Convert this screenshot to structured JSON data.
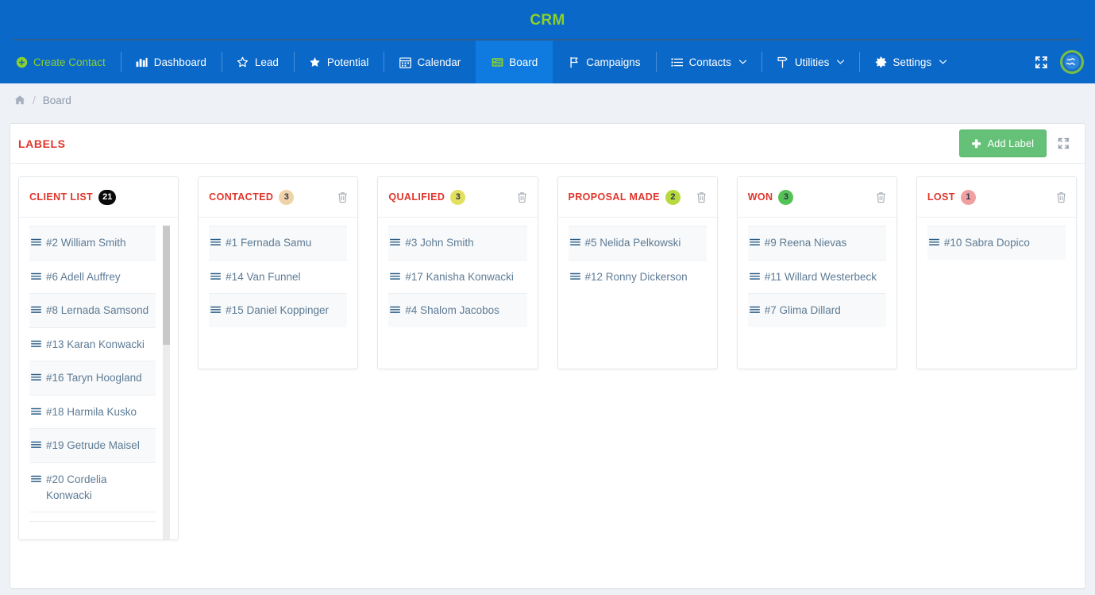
{
  "app": {
    "brand_title": "CRM",
    "brand_color": "#8ad02f",
    "header_color": "#0a68c8",
    "active_tab_color": "#0f7ae0"
  },
  "nav": {
    "items": [
      {
        "label": "Create Contact",
        "icon": "plus-circle-icon",
        "accent": true,
        "active": false,
        "caret": false
      },
      {
        "label": "Dashboard",
        "icon": "bar-chart-icon",
        "accent": false,
        "active": false,
        "caret": false
      },
      {
        "label": "Lead",
        "icon": "star-outline-icon",
        "accent": false,
        "active": false,
        "caret": false
      },
      {
        "label": "Potential",
        "icon": "star-filled-icon",
        "accent": false,
        "active": false,
        "caret": false
      },
      {
        "label": "Calendar",
        "icon": "calendar-icon",
        "accent": false,
        "active": false,
        "caret": false
      },
      {
        "label": "Board",
        "icon": "board-icon",
        "accent": false,
        "active": true,
        "caret": false
      },
      {
        "label": "Campaigns",
        "icon": "flag-icon",
        "accent": false,
        "active": false,
        "caret": false
      },
      {
        "label": "Contacts",
        "icon": "list-icon",
        "accent": false,
        "active": false,
        "caret": true
      },
      {
        "label": "Utilities",
        "icon": "signpost-icon",
        "accent": false,
        "active": false,
        "caret": true
      },
      {
        "label": "Settings",
        "icon": "gear-icon",
        "accent": false,
        "active": false,
        "caret": true
      }
    ],
    "caret_glyph": "⌄",
    "fullscreen_icon": "fullscreen-expand-icon",
    "avatar_icon": "globe-avatar-icon"
  },
  "breadcrumb": {
    "home_icon": "home-icon",
    "separator": "/",
    "current": "Board"
  },
  "panel": {
    "title": "LABELS",
    "title_color": "#e0352b",
    "add_label_button": "Add Label",
    "add_button_color": "#65c178",
    "expand_icon": "fullscreen-expand-icon"
  },
  "board": {
    "columns": [
      {
        "title": "CLIENT LIST",
        "count": "21",
        "badge_color": "#0a0a0a",
        "badge_text_color": "#ffffff",
        "deletable": false,
        "scrollable": true,
        "items": [
          {
            "label": "#2 William Smith"
          },
          {
            "label": "#6 Adell Auffrey"
          },
          {
            "label": "#8 Lernada Samsond"
          },
          {
            "label": "#13 Karan Konwacki"
          },
          {
            "label": "#16 Taryn Hoogland"
          },
          {
            "label": "#18 Harmila Kusko"
          },
          {
            "label": "#19 Getrude Maisel"
          },
          {
            "label": "#20 Cordelia Konwacki"
          }
        ]
      },
      {
        "title": "CONTACTED",
        "count": "3",
        "badge_color": "#efd3a8",
        "badge_text_color": "#33344a",
        "deletable": true,
        "scrollable": false,
        "items": [
          {
            "label": "#1 Fernada Samu"
          },
          {
            "label": "#14 Van Funnel"
          },
          {
            "label": "#15 Daniel Koppinger"
          }
        ]
      },
      {
        "title": "QUALIFIED",
        "count": "3",
        "badge_color": "#e2e05f",
        "badge_text_color": "#33344a",
        "deletable": true,
        "scrollable": false,
        "items": [
          {
            "label": "#3 John Smith"
          },
          {
            "label": "#17 Kanisha Konwacki"
          },
          {
            "label": "#4 Shalom Jacobos"
          }
        ]
      },
      {
        "title": "PROPOSAL MADE",
        "count": "2",
        "badge_color": "#b6d93e",
        "badge_text_color": "#33344a",
        "deletable": true,
        "scrollable": false,
        "items": [
          {
            "label": "#5 Nelida Pelkowski"
          },
          {
            "label": "#12 Ronny Dickerson"
          }
        ]
      },
      {
        "title": "WON",
        "count": "3",
        "badge_color": "#55c255",
        "badge_text_color": "#33344a",
        "deletable": true,
        "scrollable": false,
        "items": [
          {
            "label": "#9 Reena Nievas"
          },
          {
            "label": "#11 Willard Westerbeck"
          },
          {
            "label": "#7 Glima Dillard"
          }
        ]
      },
      {
        "title": "LOST",
        "count": "1",
        "badge_color": "#f0a0a0",
        "badge_text_color": "#33344a",
        "deletable": true,
        "scrollable": false,
        "items": [
          {
            "label": "#10 Sabra Dopico"
          }
        ]
      }
    ]
  }
}
